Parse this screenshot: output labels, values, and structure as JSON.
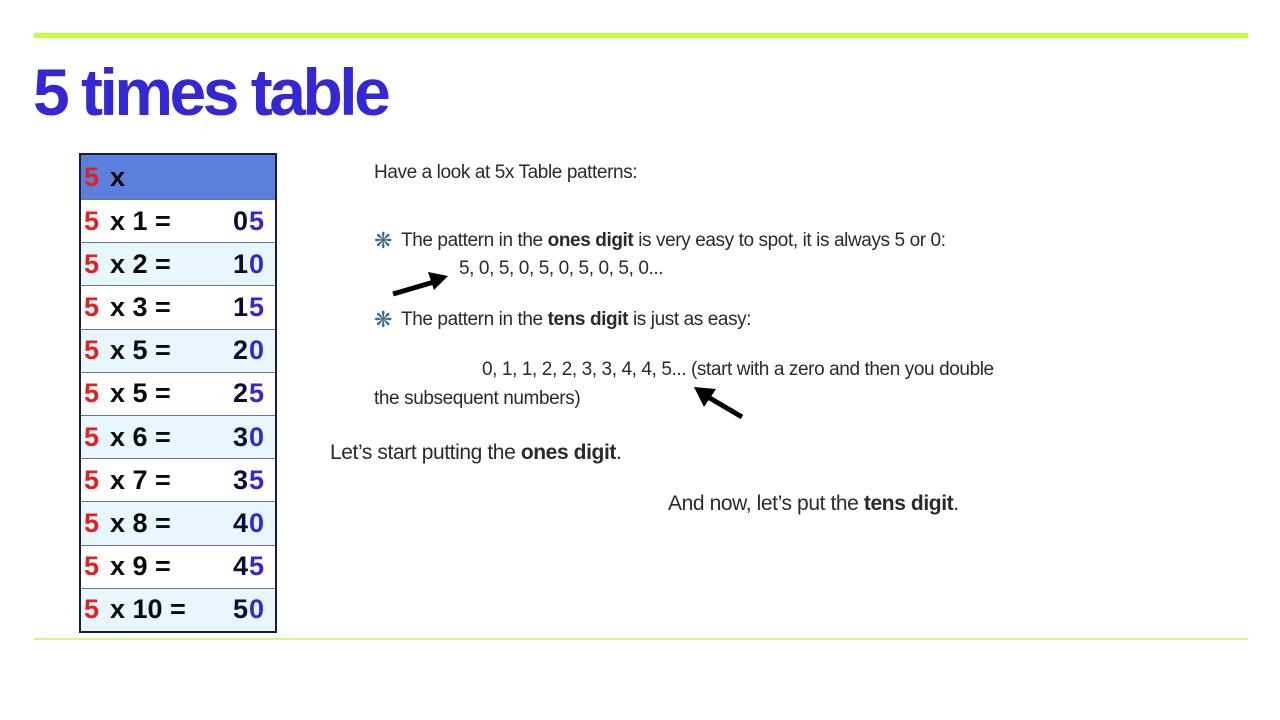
{
  "slide": {
    "title": "5 times table",
    "accent_color": "#c2ff3a",
    "title_color": "#3526d6"
  },
  "table": {
    "header": {
      "multiplier": "5",
      "op": "x"
    },
    "rows": [
      {
        "multiplier": "5",
        "expr": "x 1 =",
        "tens": "0",
        "ones": "5"
      },
      {
        "multiplier": "5",
        "expr": "x 2 =",
        "tens": "1",
        "ones": "0"
      },
      {
        "multiplier": "5",
        "expr": "x 3 =",
        "tens": "1",
        "ones": "5"
      },
      {
        "multiplier": "5",
        "expr": "x 5 =",
        "tens": "2",
        "ones": "0"
      },
      {
        "multiplier": "5",
        "expr": "x 5 =",
        "tens": "2",
        "ones": "5"
      },
      {
        "multiplier": "5",
        "expr": "x 6 =",
        "tens": "3",
        "ones": "0"
      },
      {
        "multiplier": "5",
        "expr": "x 7 =",
        "tens": "3",
        "ones": "5"
      },
      {
        "multiplier": "5",
        "expr": "x 8 =",
        "tens": "4",
        "ones": "0"
      },
      {
        "multiplier": "5",
        "expr": "x 9 =",
        "tens": "4",
        "ones": "5"
      },
      {
        "multiplier": "5",
        "expr": "x 10 =",
        "tens": "5",
        "ones": "0"
      }
    ],
    "colors": {
      "multiplier": "#e3201e",
      "tens": "#0b0b33",
      "ones": "#3526d6",
      "header_bg": "#5b7fdc",
      "alt_row_bg": "#e7f7fd"
    }
  },
  "content": {
    "intro": "Have a look at  5x Table patterns:",
    "bullet1": {
      "icon": "sparkle-icon",
      "pre": "The pattern in the ",
      "bold": "ones digit",
      "post": " is very easy to spot, it is always 5 or 0:"
    },
    "sequence1": "5, 0, 5, 0, 5, 0, 5, 0, 5, 0...",
    "bullet2": {
      "icon": "sparkle-icon",
      "pre": "The pattern in the ",
      "bold": "tens digit",
      "post": " is just as easy:"
    },
    "sequence2": "0, 1, 1, 2, 2, 3, 3, 4, 4, 5... (start with a zero and then you double",
    "sequence2_cont": "the subsequent numbers)",
    "step1": {
      "pre": "Let’s start putting the ",
      "bold": "ones digit",
      "post": "."
    },
    "step2": {
      "pre": "And now, let’s put the ",
      "bold": "tens digit",
      "post": "."
    }
  }
}
